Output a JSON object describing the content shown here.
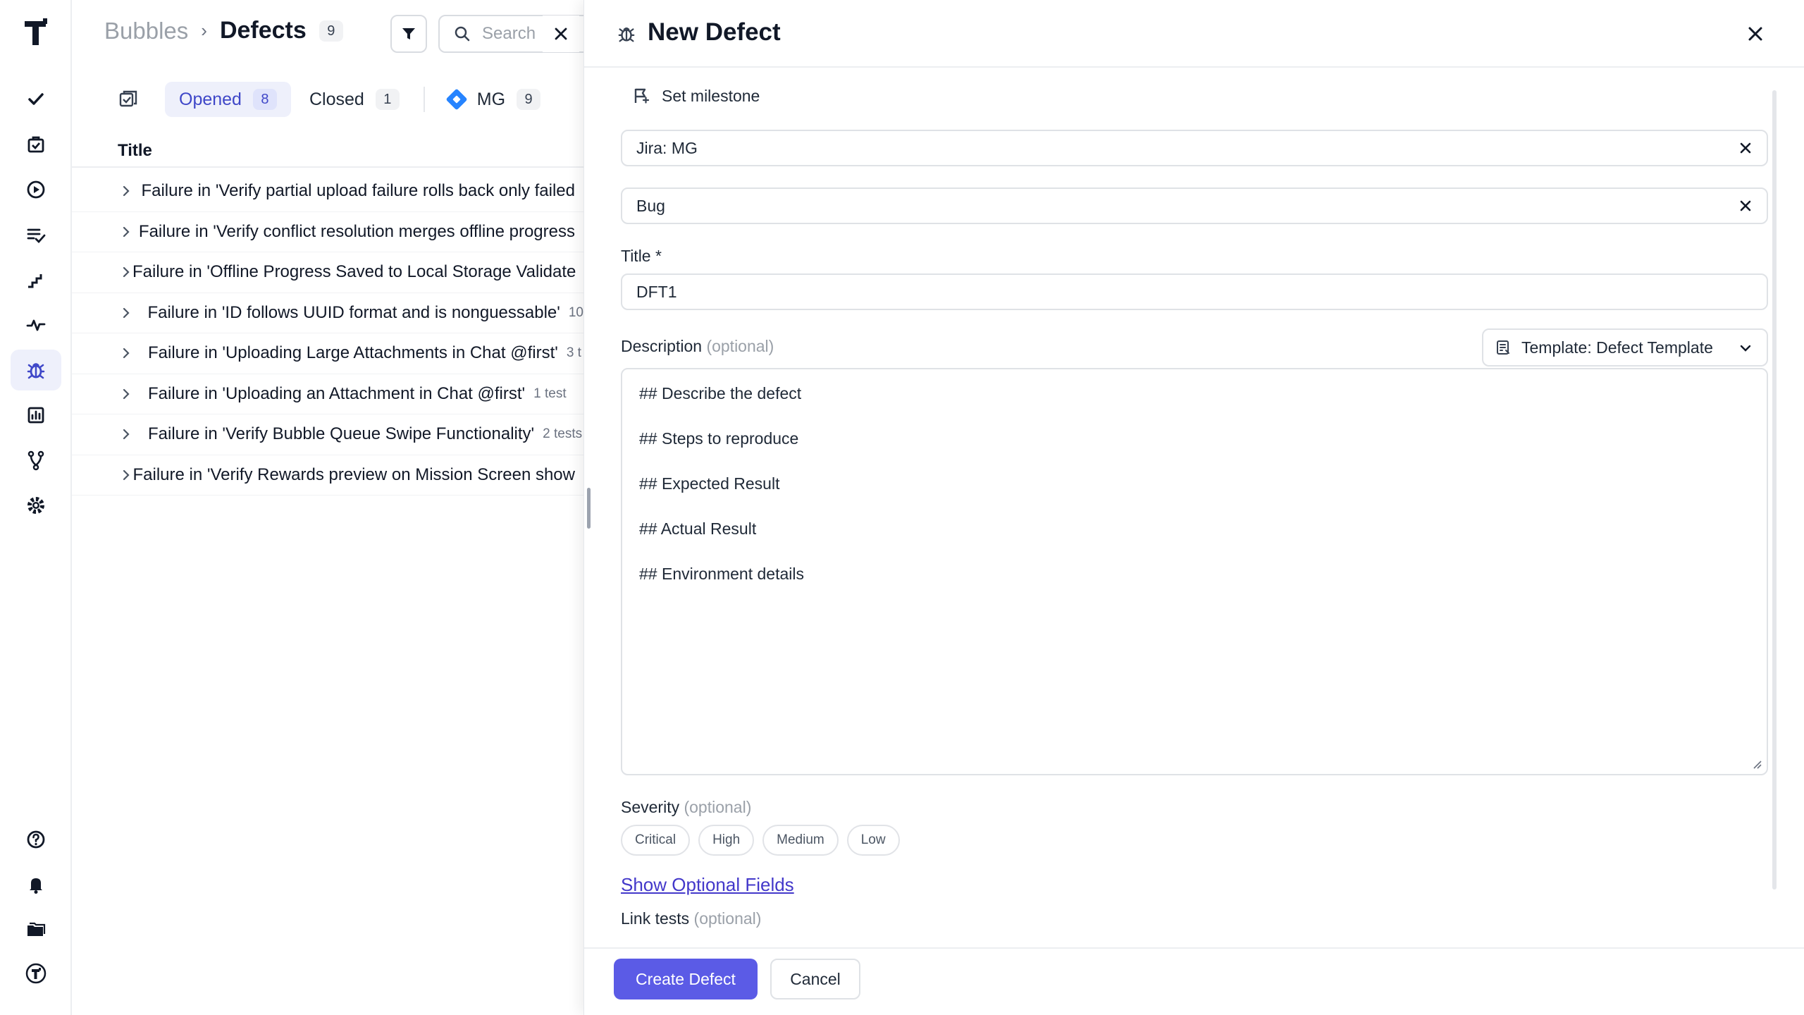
{
  "list": {
    "breadcrumb_parent": "Bubbles",
    "breadcrumb_current": "Defects",
    "total_count": "9",
    "search_placeholder": "Search",
    "tabs": [
      {
        "label": "Opened",
        "count": "8"
      },
      {
        "label": "Closed",
        "count": "1"
      },
      {
        "label": "MG",
        "count": "9"
      }
    ],
    "column_title": "Title",
    "rows": [
      {
        "title": "Failure in 'Verify partial upload failure rolls back only failed",
        "meta": ""
      },
      {
        "title": "Failure in 'Verify conflict resolution merges offline progress",
        "meta": ""
      },
      {
        "title": "Failure in 'Offline Progress Saved to Local Storage Validate",
        "meta": ""
      },
      {
        "title": "Failure in 'ID follows UUID format and is nonguessable'",
        "meta": "10"
      },
      {
        "title": "Failure in 'Uploading Large Attachments in Chat @first'",
        "meta": "3 t"
      },
      {
        "title": "Failure in 'Uploading an Attachment in Chat @first'",
        "meta": "1 test"
      },
      {
        "title": "Failure in 'Verify Bubble Queue Swipe Functionality'",
        "meta": "2 tests"
      },
      {
        "title": "Failure in 'Verify Rewards preview on Mission Screen show",
        "meta": ""
      }
    ]
  },
  "panel": {
    "title": "New Defect",
    "set_milestone": "Set milestone",
    "jira_value": "Jira: MG",
    "issue_type": "Bug",
    "title_label": "Title *",
    "title_value": "DFT1",
    "description_label": "Description",
    "optional": "(optional)",
    "template_label": "Template: Defect Template",
    "description_lines": [
      "## Describe the defect",
      "## Steps to reproduce",
      "## Expected Result",
      "## Actual Result",
      "## Environment details"
    ],
    "severity_label": "Severity",
    "severity_options": [
      "Critical",
      "High",
      "Medium",
      "Low"
    ],
    "show_optional": "Show Optional Fields",
    "link_tests_label": "Link tests",
    "create_button": "Create Defect",
    "cancel_button": "Cancel"
  },
  "colors": {
    "accent": "#5b5be6",
    "active_tab_bg": "#eef0fb",
    "jira_blue": "#2684ff"
  }
}
